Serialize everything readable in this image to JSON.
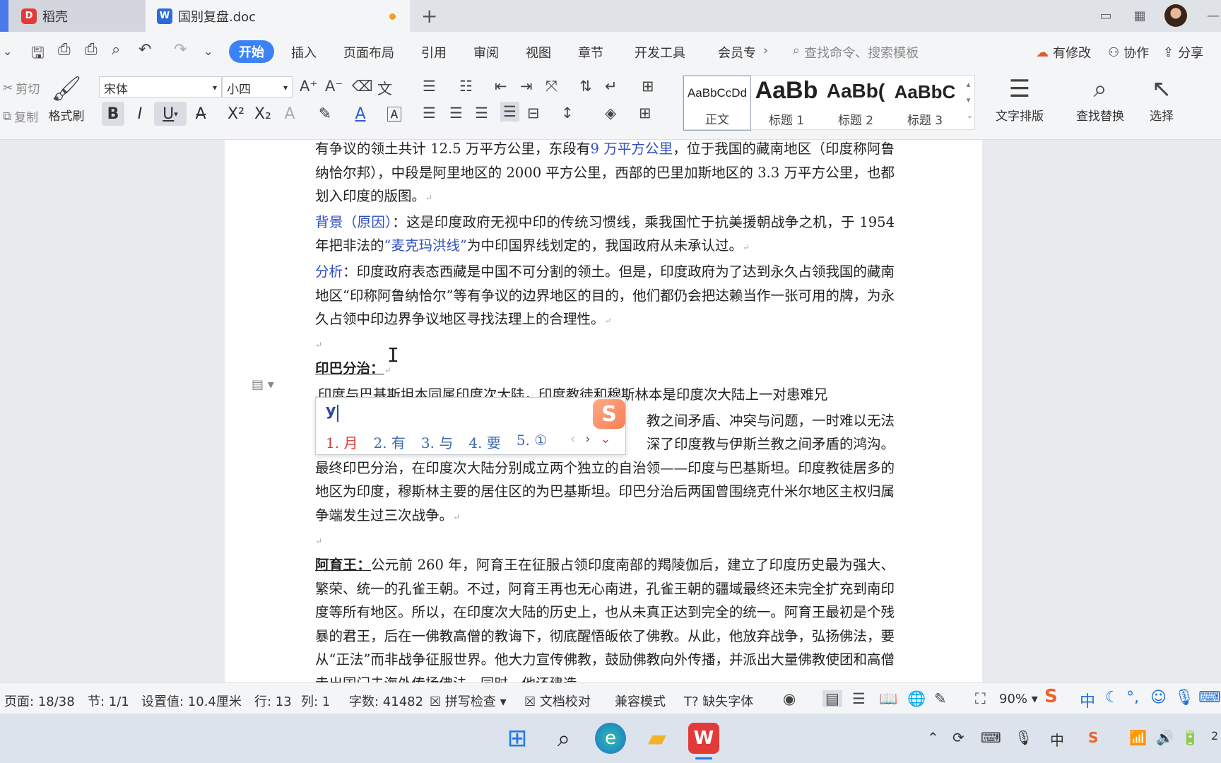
{
  "tabs": [
    {
      "label": "稻壳",
      "icon": "daoke-logo-icon"
    },
    {
      "label": "国别复盘.doc",
      "icon": "wps-writer-icon",
      "modified": true
    }
  ],
  "menu": {
    "items": [
      "开始",
      "插入",
      "页面布局",
      "引用",
      "审阅",
      "视图",
      "章节",
      "开发工具",
      "会员专"
    ],
    "search_placeholder": "查找命令、搜索模板",
    "right": [
      "有修改",
      "协作",
      "分享"
    ]
  },
  "ribbon": {
    "cut": "剪切",
    "copy": "复制",
    "format_painter": "格式刷",
    "font_name": "宋体",
    "font_size": "小四",
    "styles": [
      {
        "sample": "AaBbCcDd",
        "label": "正文"
      },
      {
        "sample": "AaBb",
        "label": "标题 1"
      },
      {
        "sample": "AaBb(",
        "label": "标题 2"
      },
      {
        "sample": "AaBbC",
        "label": "标题 3"
      }
    ],
    "text_layout": "文字排版",
    "find_replace": "查找替换",
    "select": "选择"
  },
  "document": {
    "p1": "有争议的领土共计 12.5 万平方公里，东段有",
    "p1_link": "9 万平方公里",
    "p1_rest": "，位于我国的藏南地区（印度称阿鲁纳恰尔邦），中段是阿里地区的 2000 平方公里，西部的巴里加斯地区的 3.3 万平方公里，也都划入印度的版图。",
    "p2_label": "背景（原因）",
    "p2_a": "：这是印度政府无视中印的传统习惯线，乘我国忙于抗美援朝战争之机，于 1954 年把非法的",
    "p2_link": "“麦克玛洪线”",
    "p2_b": "为中印国界线划定的，我国政府从未承认过。",
    "p3_label": "分析",
    "p3": "：印度政府表态西藏是中国不可分割的领土。但是，印度政府为了达到永久占领我国的藏南地区“印称阿鲁纳恰尔”等有争议的边界地区的目的，他们都仍会把达赖当作一张可用的牌，为永久占领中印边界争议地区寻找法理上的合理性。",
    "h1": "印巴分治：",
    "p4_line1": "印度与巴基斯坦本同属印度次大陆，印度教徒和穆斯林本是印度次大陆上一对患难兄",
    "p4_line2_tail": "教之间矛盾、冲突与问题，一时难以无法",
    "p4_line3_tail": "深了印度教与伊斯兰教之间矛盾的鸿沟。",
    "p4_rest": "最终印巴分治，在印度次大陆分别成立两个独立的自治领——印度与巴基斯坦。印度教徒居多的地区为印度，穆斯林主要的居住区的为巴基斯坦。印巴分治后两国曾围绕克什米尔地区主权归属争端发生过三次战争。",
    "h2": "阿育王：",
    "p5": "公元前 260 年，阿育王在征服占领印度南部的羯陵伽后，建立了印度历史最为强大、繁荣、统一的孔雀王朝。不过，阿育王再也无心南进，孔雀王朝的疆域最终还未完全扩充到南印度等所有地区。所以，在印度次大陆的历史上，也从未真正达到完全的统一。阿育王最初是个残暴的君王，后在一佛教高僧的教诲下，彻底醒悟皈依了佛教。从此，他放弃战争，弘扬佛法，要从“正法”而非战争征服世界。他大力宣传佛教，鼓励佛教向外传播，并派出大量佛教使团和高僧走出国门去海外传扬佛法。同时，他还建造"
  },
  "ime": {
    "input": "y",
    "candidates": [
      "1. 月",
      "2. 有",
      "3. 与",
      "4. 要",
      "5. ①"
    ]
  },
  "status": {
    "page": "页面: 18/38",
    "section": "节: 1/1",
    "setting": "设置值: 10.4厘米",
    "row": "行: 13",
    "col": "列: 1",
    "words": "字数: 41482",
    "spell": "拼写检查",
    "proof": "文档校对",
    "compat": "兼容模式",
    "missing_font": "缺失字体",
    "zoom": "90%"
  },
  "taskbar": {
    "tray_lang": "中",
    "clock_partial": "2"
  }
}
